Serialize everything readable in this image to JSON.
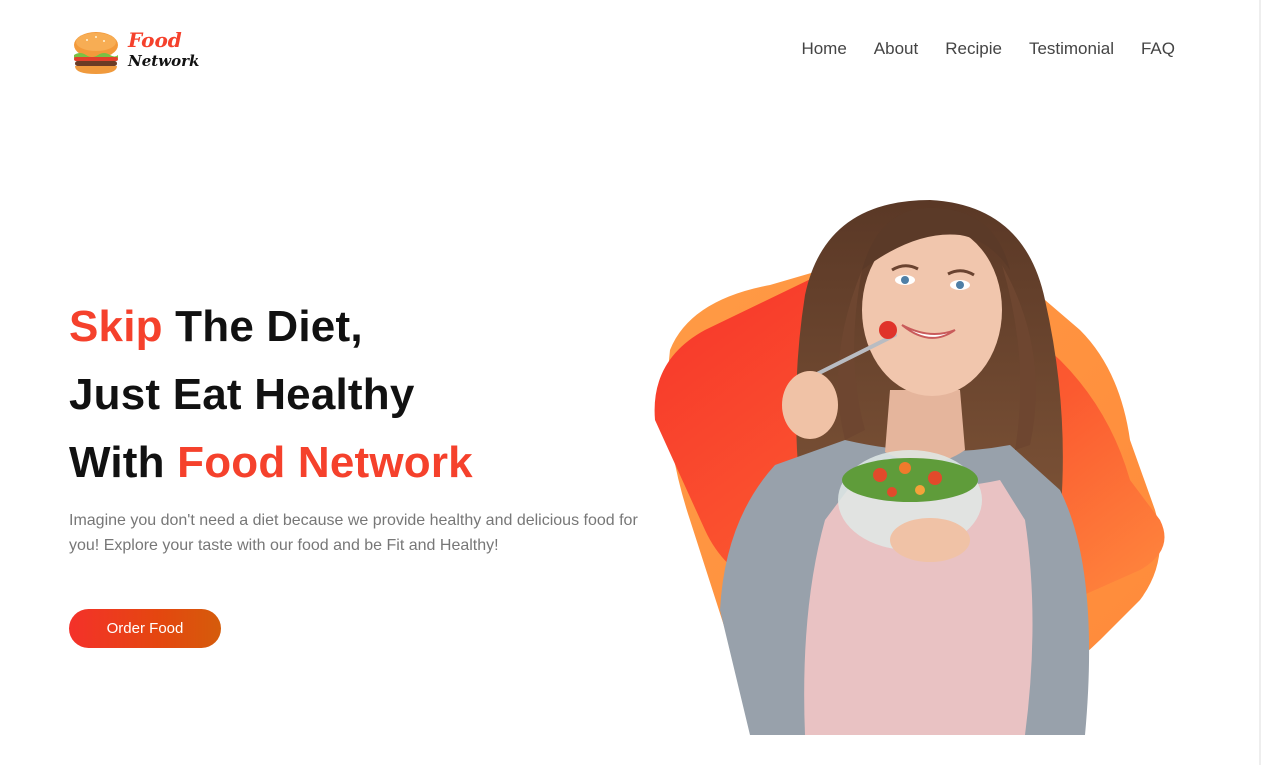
{
  "brand": {
    "line1": "Food",
    "line2": "Network",
    "logo_icon": "burger-icon"
  },
  "nav": {
    "items": [
      {
        "label": "Home"
      },
      {
        "label": "About"
      },
      {
        "label": "Recipie"
      },
      {
        "label": "Testimonial"
      },
      {
        "label": "FAQ"
      }
    ]
  },
  "hero": {
    "title": {
      "line1_accent": "Skip",
      "line1_rest": " The Diet,",
      "line2": "Just Eat Healthy",
      "line3_lead": "With ",
      "line3_accent": "Food Network"
    },
    "description": "Imagine you don't need a diet because we provide healthy and delicious food for you! Explore your taste with our food and be Fit and Healthy!",
    "cta_label": "Order Food"
  },
  "colors": {
    "accent": "#f5412c",
    "heading": "#111111",
    "body_text": "#777777",
    "nav_text": "#444444",
    "blob_light": "#ff9a4a",
    "blob_dark": "#f63b2c"
  }
}
